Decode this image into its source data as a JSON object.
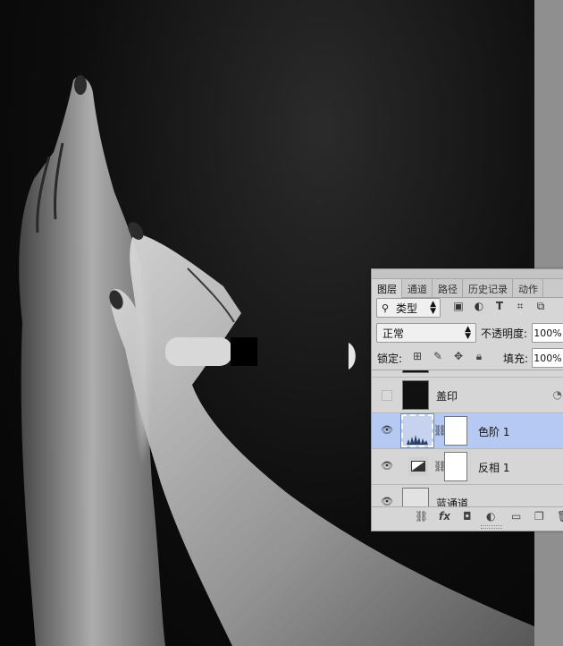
{
  "tabs": [
    {
      "label": "图层",
      "active": true
    },
    {
      "label": "通道",
      "active": false
    },
    {
      "label": "路径",
      "active": false
    },
    {
      "label": "历史记录",
      "active": false
    },
    {
      "label": "动作",
      "active": false
    }
  ],
  "filter": {
    "label": "类型",
    "search_icon": "search-icon",
    "icons": [
      "image-filter-icon",
      "adjustment-filter-icon",
      "type-filter-icon",
      "shape-filter-icon",
      "smart-object-filter-icon"
    ]
  },
  "blend_mode": "正常",
  "opacity": {
    "label": "不透明度:",
    "value": "100%"
  },
  "lock": {
    "label": "锁定:",
    "icons": [
      "lock-transparent-icon",
      "lock-paint-icon",
      "lock-position-icon",
      "lock-all-icon"
    ]
  },
  "fill": {
    "label": "填充:",
    "value": "100%"
  },
  "layers": [
    {
      "name": "盖印",
      "visible": false,
      "selected": false
    },
    {
      "name": "色阶 1",
      "visible": true,
      "selected": true
    },
    {
      "name": "反相 1",
      "visible": true,
      "selected": false
    },
    {
      "name": "蓝通道",
      "visible": true,
      "selected": false
    }
  ],
  "bottom_icons": [
    "link-icon",
    "fx-icon",
    "mask-icon",
    "adjustment-icon",
    "folder-icon",
    "new-layer-icon",
    "trash-icon"
  ],
  "colors": {
    "selected_row": "#b5c9f3",
    "panel_bg": "#d6d6d6"
  }
}
